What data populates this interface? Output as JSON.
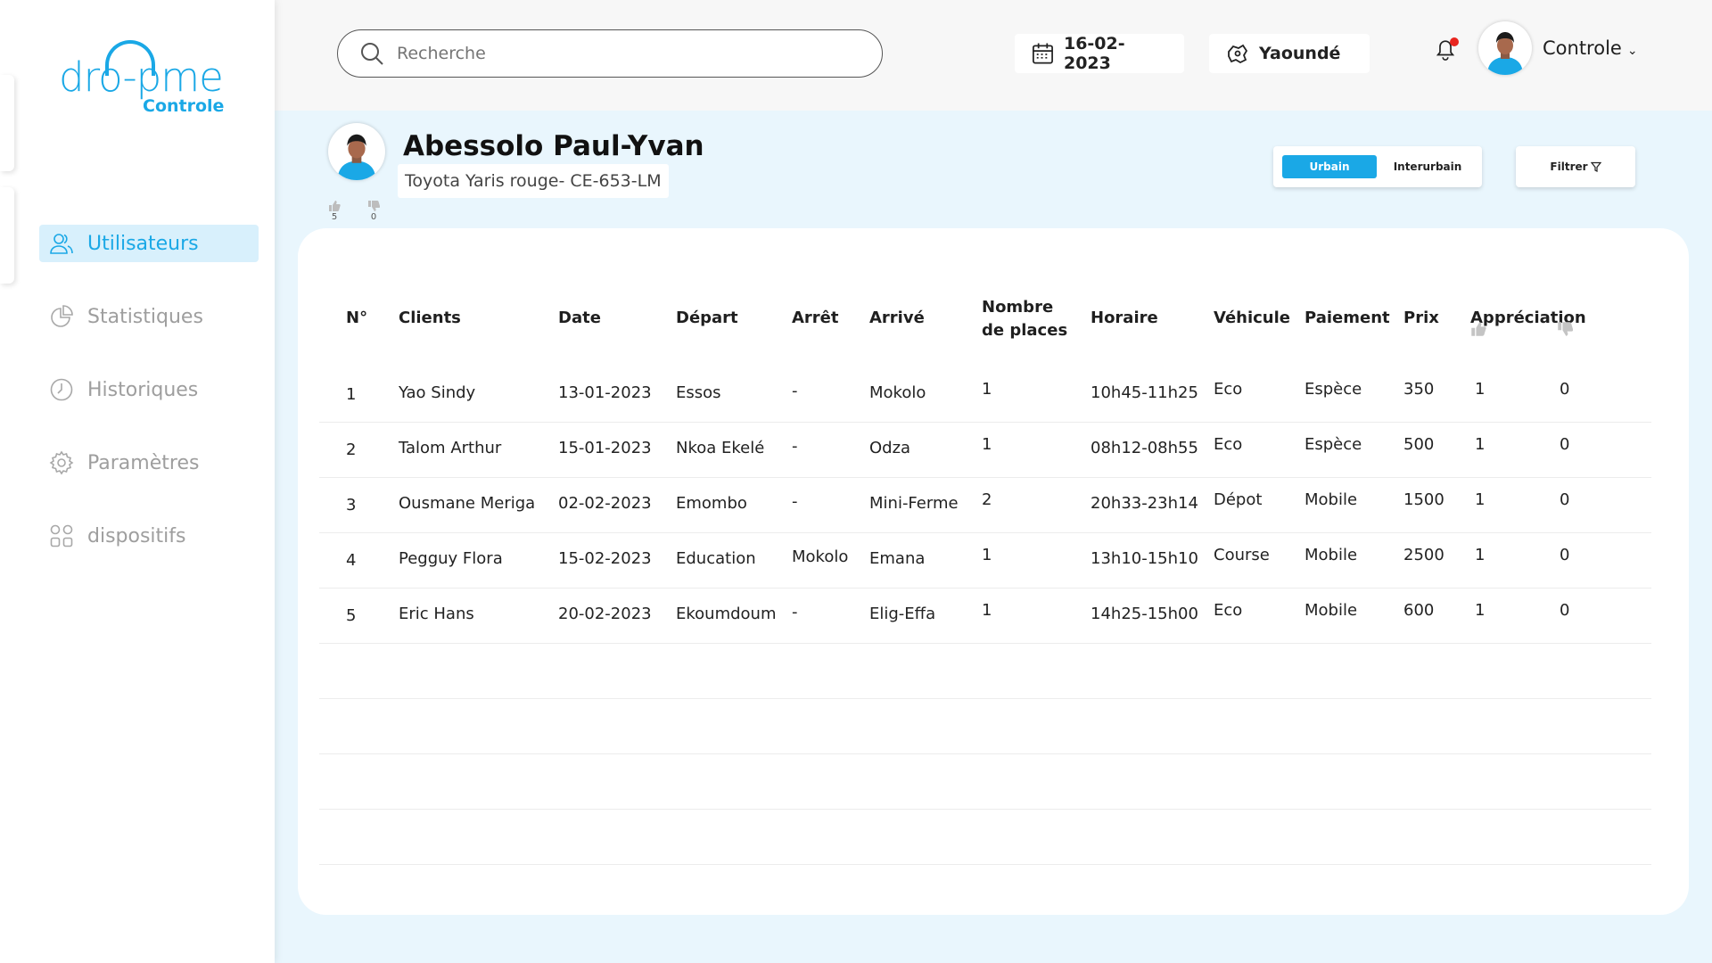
{
  "brand": {
    "logo_text": "dro-pme",
    "logo_sub": "Controle",
    "accent": "#1aa8e6"
  },
  "sidebar": {
    "items": [
      {
        "label": "Utilisateurs",
        "icon": "users-icon",
        "active": true
      },
      {
        "label": "Statistiques",
        "icon": "pie-chart-icon",
        "active": false
      },
      {
        "label": "Historiques",
        "icon": "clock-icon",
        "active": false
      },
      {
        "label": "Paramètres",
        "icon": "gear-icon",
        "active": false
      },
      {
        "label": "dispositifs",
        "icon": "grid-icon",
        "active": false
      }
    ]
  },
  "topbar": {
    "search_placeholder": "Recherche",
    "date": "16-02-2023",
    "city": "Yaoundé",
    "user_name": "Controle",
    "notification_color": "#e8251f"
  },
  "driver": {
    "name": "Abessolo Paul-Yvan",
    "vehicle": "Toyota Yaris rouge- CE-653-LM",
    "likes": "5",
    "dislikes": "0"
  },
  "controls": {
    "segment_on": "Urbain",
    "segment_off": "Interurbain",
    "filter_label": "Filtrer"
  },
  "table": {
    "headers": {
      "no": "N°",
      "clients": "Clients",
      "date": "Date",
      "depart": "Départ",
      "arret": "Arrêt",
      "arrive": "Arrivé",
      "places_1": "Nombre",
      "places_2": "de places",
      "horaire": "Horaire",
      "vehicule": "Véhicule",
      "paiement": "Paiement",
      "prix": "Prix",
      "appreciation": "Appréciation"
    },
    "rows": [
      {
        "no": "1",
        "client": "Yao Sindy",
        "date": "13-01-2023",
        "depart": "Essos",
        "arret": "-",
        "arrive": "Mokolo",
        "places": "1",
        "horaire": "10h45-11h25",
        "vehicule": "Eco",
        "paiement": "Espèce",
        "prix": "350",
        "up": "1",
        "down": "0"
      },
      {
        "no": "2",
        "client": "Talom Arthur",
        "date": "15-01-2023",
        "depart": "Nkoa Ekelé",
        "arret": "-",
        "arrive": "Odza",
        "places": "1",
        "horaire": "08h12-08h55",
        "vehicule": "Eco",
        "paiement": "Espèce",
        "prix": "500",
        "up": "1",
        "down": "0"
      },
      {
        "no": "3",
        "client": "Ousmane Meriga",
        "date": "02-02-2023",
        "depart": "Emombo",
        "arret": "-",
        "arrive": "Mini-Ferme",
        "places": "2",
        "horaire": "20h33-23h14",
        "vehicule": "Dépot",
        "paiement": "Mobile",
        "prix": "1500",
        "up": "1",
        "down": "0"
      },
      {
        "no": "4",
        "client": "Pegguy Flora",
        "date": "15-02-2023",
        "depart": "Education",
        "arret": "Mokolo",
        "arrive": "Emana",
        "places": "1",
        "horaire": "13h10-15h10",
        "vehicule": "Course",
        "paiement": "Mobile",
        "prix": "2500",
        "up": "1",
        "down": "0"
      },
      {
        "no": "5",
        "client": "Eric Hans",
        "date": "20-02-2023",
        "depart": "Ekoumdoum",
        "arret": "-",
        "arrive": "Elig-Effa",
        "places": "1",
        "horaire": "14h25-15h00",
        "vehicule": "Eco",
        "paiement": "Mobile",
        "prix": "600",
        "up": "1",
        "down": "0"
      }
    ],
    "empty_rows": 4
  }
}
